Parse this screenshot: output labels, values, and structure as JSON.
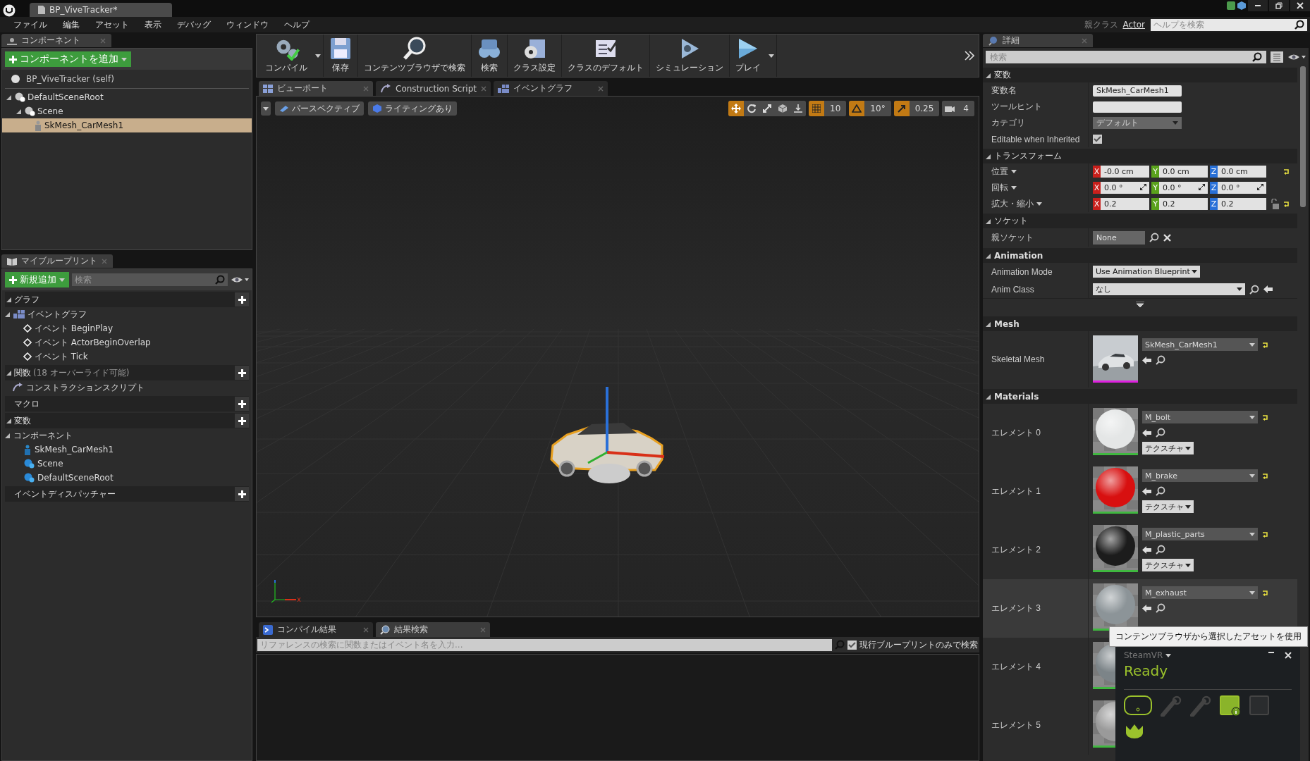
{
  "title_bar": {
    "tabs": [
      {
        "label": "BP_ViveTracker*",
        "selected": true
      }
    ]
  },
  "menu": [
    "ファイル",
    "編集",
    "アセット",
    "表示",
    "デバッグ",
    "ウィンドウ",
    "ヘルプ"
  ],
  "parent_class": {
    "label": "親クラス",
    "value": "Actor"
  },
  "help_search": {
    "placeholder": "ヘルプを検索"
  },
  "components": {
    "tab": "コンポーネント",
    "add_button": "コンポーネントを追加",
    "self": "BP_ViveTracker (self)",
    "tree": [
      {
        "label": "DefaultSceneRoot",
        "kind": "scene",
        "selected": false,
        "children": [
          {
            "label": "Scene",
            "kind": "scene",
            "selected": false,
            "children": [
              {
                "label": "SkMesh_CarMesh1",
                "kind": "mesh",
                "selected": true
              }
            ]
          }
        ]
      }
    ]
  },
  "my_blueprint": {
    "tab": "マイブループリント",
    "add_button": "新規追加",
    "search": {
      "placeholder": "検索"
    },
    "sections": [
      {
        "title": "グラフ",
        "items": [
          {
            "label": "イベントグラフ",
            "kind": "graph",
            "children": [
              {
                "label": "イベント BeginPlay",
                "kind": "event"
              },
              {
                "label": "イベント ActorBeginOverlap",
                "kind": "event"
              },
              {
                "label": "イベント Tick",
                "kind": "event"
              }
            ]
          }
        ]
      },
      {
        "title": "関数",
        "note": "(18 オーバーライド可能)",
        "items": [
          {
            "label": "コンストラクションスクリプト",
            "kind": "function"
          }
        ]
      },
      {
        "title": "マクロ"
      },
      {
        "title": "変数",
        "items": [
          {
            "label": "コンポーネント",
            "kind": "category",
            "children": [
              {
                "label": "SkMesh_CarMesh1",
                "kind": "mesh-var"
              },
              {
                "label": "Scene",
                "kind": "scene-var"
              },
              {
                "label": "DefaultSceneRoot",
                "kind": "scene-var"
              }
            ]
          }
        ]
      },
      {
        "title": "イベントディスパッチャー"
      }
    ]
  },
  "toolbar": [
    {
      "label": "コンパイル",
      "kind": "compile",
      "menu": true
    },
    {
      "label": "保存",
      "kind": "save",
      "menu": false
    },
    {
      "label": "コンテンツブラウザで検索",
      "kind": "browse",
      "menu": false
    },
    {
      "label": "検索",
      "kind": "find",
      "menu": false
    },
    {
      "label": "クラス設定",
      "kind": "settings",
      "menu": false
    },
    {
      "label": "クラスのデフォルト",
      "kind": "defaults",
      "menu": false
    },
    {
      "label": "シミュレーション",
      "kind": "simulate",
      "menu": false
    },
    {
      "label": "プレイ",
      "kind": "play",
      "menu": true
    }
  ],
  "editor_tabs": [
    {
      "label": "ビューポート",
      "kind": "viewport",
      "selected": true
    },
    {
      "label": "Construction Script",
      "kind": "function",
      "selected": false
    },
    {
      "label": "イベントグラフ",
      "kind": "graph",
      "selected": false
    }
  ],
  "viewport_toolbar": {
    "view_mode": "パースペクティブ",
    "lighting": "ライティングあり",
    "tools": [
      {
        "kind": "translate",
        "on": true
      },
      {
        "kind": "rotate",
        "on": false
      },
      {
        "kind": "scale",
        "on": false
      },
      {
        "kind": "world",
        "on": false
      },
      {
        "kind": "surface",
        "on": false
      }
    ],
    "snaps": [
      {
        "kind": "grid",
        "on": true,
        "value": "10"
      },
      {
        "kind": "angle",
        "on": true,
        "value": "10°"
      },
      {
        "kind": "scale",
        "on": true,
        "value": "0.25"
      },
      {
        "kind": "camera",
        "on": false,
        "value": "4"
      }
    ]
  },
  "bottom": {
    "tabs": [
      {
        "label": "コンパイル結果",
        "kind": "log",
        "selected": false
      },
      {
        "label": "結果検索",
        "kind": "find",
        "selected": true
      }
    ],
    "search": {
      "placeholder": "リファレンスの検索に関数またはイベント名を入力..."
    },
    "option": {
      "label": "現行ブループリントのみで検索",
      "checked": true
    }
  },
  "details": {
    "tab": "詳細",
    "search": {
      "placeholder": "検索"
    },
    "sections": [
      {
        "title": "変数",
        "rows": [
          {
            "label": "変数名",
            "kind": "text",
            "value": "SkMesh_CarMesh1"
          },
          {
            "label": "ツールヒント",
            "kind": "text"
          },
          {
            "label": "カテゴリ",
            "kind": "combo",
            "value": "デフォルト"
          },
          {
            "label": "Editable when Inherited",
            "kind": "checkbox",
            "checked": true
          }
        ]
      },
      {
        "title": "トランスフォーム",
        "rows": [
          {
            "label": "位置",
            "kind": "vector",
            "values": [
              {
                "axis": "X",
                "value": "-0.0 cm"
              },
              {
                "axis": "Y",
                "value": "0.0 cm"
              },
              {
                "axis": "Z",
                "value": "0.0 cm"
              }
            ],
            "reset": true,
            "lock": false
          },
          {
            "label": "回転",
            "kind": "rotator",
            "values": [
              {
                "axis": "X",
                "value": "0.0 °"
              },
              {
                "axis": "Y",
                "value": "0.0 °"
              },
              {
                "axis": "Z",
                "value": "0.0 °"
              }
            ],
            "reset": false,
            "lock": false
          },
          {
            "label": "拡大・縮小",
            "kind": "vector",
            "values": [
              {
                "axis": "X",
                "value": "0.2"
              },
              {
                "axis": "Y",
                "value": "0.2"
              },
              {
                "axis": "Z",
                "value": "0.2"
              }
            ],
            "reset": true,
            "lock": true
          }
        ]
      },
      {
        "title": "ソケット",
        "rows": [
          {
            "label": "親ソケット",
            "kind": "socket",
            "value": "None"
          }
        ]
      },
      {
        "title": "Animation",
        "rows": [
          {
            "label": "Animation Mode",
            "kind": "dropdown",
            "value": "Use Animation Blueprint"
          },
          {
            "label": "Anim Class",
            "kind": "class",
            "value": "なし"
          },
          {
            "kind": "advanced"
          }
        ]
      },
      {
        "title": "Mesh",
        "rows": [
          {
            "label": "Skeletal Mesh",
            "kind": "asset",
            "value": "SkMesh_CarMesh1"
          }
        ]
      },
      {
        "title": "Materials",
        "rows": [
          {
            "label": "エレメント 0",
            "kind": "material",
            "value": "M_bolt",
            "button": "テクスチャ",
            "color": "#e4e6e6",
            "highlighted": false
          },
          {
            "label": "エレメント 1",
            "kind": "material",
            "value": "M_brake",
            "button": "テクスチャ",
            "color": "#d81010",
            "highlighted": false
          },
          {
            "label": "エレメント 2",
            "kind": "material",
            "value": "M_plastic_parts",
            "button": "テクスチャ",
            "color": "#1c1c1c",
            "highlighted": false
          },
          {
            "label": "エレメント 3",
            "kind": "material",
            "value": "M_exhaust",
            "color": "#8c9498",
            "highlighted": true
          },
          {
            "label": "エレメント 4",
            "kind": "material",
            "color": "#7c8488",
            "highlighted": false
          },
          {
            "label": "エレメント 5",
            "kind": "material",
            "color": "#9a9a9a",
            "highlighted": false
          }
        ]
      }
    ]
  },
  "tooltip": "コンテンツブラウザから選択したアセットを使用",
  "steamvr": {
    "title": "SteamVR",
    "status": "Ready",
    "devices": [
      {
        "kind": "headset",
        "on": true
      },
      {
        "kind": "controller",
        "on": false
      },
      {
        "kind": "controller",
        "on": false
      },
      {
        "kind": "base-station",
        "on": true
      },
      {
        "kind": "base-station",
        "on": false
      },
      {
        "kind": "tracker",
        "on": true
      }
    ]
  }
}
